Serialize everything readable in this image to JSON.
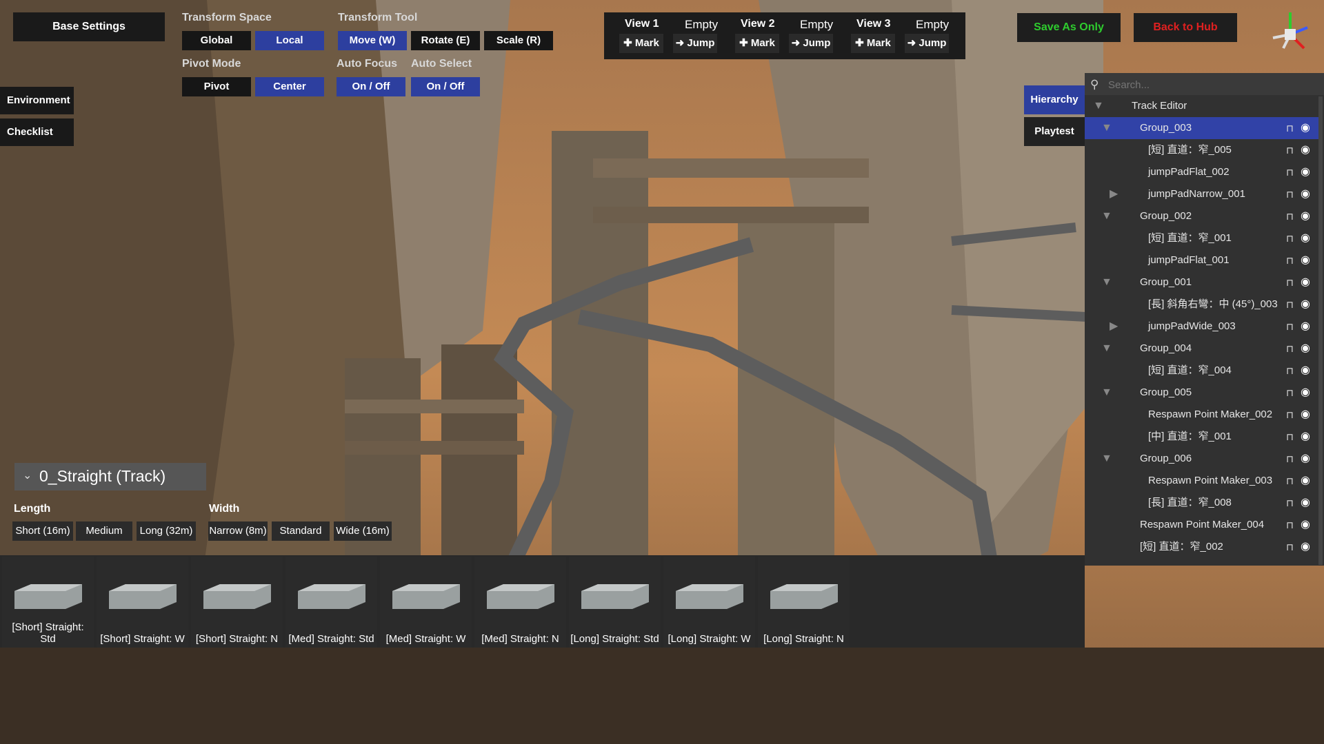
{
  "top": {
    "base_settings": "Base Settings",
    "transform_space": {
      "label": "Transform Space",
      "global": "Global",
      "local": "Local"
    },
    "transform_tool": {
      "label": "Transform Tool",
      "move": "Move (W)",
      "rotate": "Rotate (E)",
      "scale": "Scale (R)"
    },
    "pivot_mode": {
      "label": "Pivot Mode",
      "pivot": "Pivot",
      "center": "Center"
    },
    "auto_focus": {
      "label": "Auto Focus",
      "toggle": "On / Off"
    },
    "auto_select": {
      "label": "Auto Select",
      "toggle": "On / Off"
    },
    "save": "Save As Only",
    "back": "Back to Hub"
  },
  "views": [
    {
      "title": "View 1",
      "empty": "Empty",
      "mark": "✚ Mark",
      "jump": "➜ Jump"
    },
    {
      "title": "View 2",
      "empty": "Empty",
      "mark": "✚ Mark",
      "jump": "➜ Jump"
    },
    {
      "title": "View 3",
      "empty": "Empty",
      "mark": "✚ Mark",
      "jump": "➜ Jump"
    }
  ],
  "left": {
    "environment": "Environment",
    "checklist": "Checklist"
  },
  "tabs": {
    "hierarchy": "Hierarchy",
    "playtest": "Playtest"
  },
  "hierarchy": {
    "search_placeholder": "Search...",
    "items": [
      {
        "name": "Track Editor",
        "arrow": "▼"
      },
      {
        "name": "Group_003",
        "arrow": "▼"
      },
      {
        "name": "[短] 直道：窄_005",
        "arrow": ""
      },
      {
        "name": "jumpPadFlat_002",
        "arrow": ""
      },
      {
        "name": "jumpPadNarrow_001",
        "arrow": "▶"
      },
      {
        "name": "Group_002",
        "arrow": "▼"
      },
      {
        "name": "[短] 直道：窄_001",
        "arrow": ""
      },
      {
        "name": "jumpPadFlat_001",
        "arrow": ""
      },
      {
        "name": "Group_001",
        "arrow": "▼"
      },
      {
        "name": "[長] 斜角右彎：中 (45°)_003",
        "arrow": ""
      },
      {
        "name": "jumpPadWide_003",
        "arrow": "▶"
      },
      {
        "name": "Group_004",
        "arrow": "▼"
      },
      {
        "name": "[短] 直道：窄_004",
        "arrow": ""
      },
      {
        "name": "Group_005",
        "arrow": "▼"
      },
      {
        "name": "Respawn Point Maker_002",
        "arrow": ""
      },
      {
        "name": "[中] 直道：窄_001",
        "arrow": ""
      },
      {
        "name": "Group_006",
        "arrow": "▼"
      },
      {
        "name": "Respawn Point Maker_003",
        "arrow": ""
      },
      {
        "name": "[長] 直道：窄_008",
        "arrow": ""
      },
      {
        "name": "Respawn Point Maker_004",
        "arrow": ""
      },
      {
        "name": "[短] 直道：窄_002",
        "arrow": ""
      }
    ]
  },
  "track": {
    "selected": "0_Straight (Track)",
    "length_label": "Length",
    "length_options": [
      "Short (16m)",
      "Medium",
      "Long (32m)"
    ],
    "width_label": "Width",
    "width_options": [
      "Narrow (8m)",
      "Standard",
      "Wide (16m)"
    ]
  },
  "pieces": [
    "[Short] Straight: Std",
    "[Short] Straight: W",
    "[Short] Straight: N",
    "[Med] Straight: Std",
    "[Med] Straight: W",
    "[Med] Straight: N",
    "[Long] Straight: Std",
    "[Long] Straight: W",
    "[Long] Straight: N"
  ],
  "colors": {
    "accent_blue": "#2d3f9f",
    "save_green": "#2ecc2e",
    "back_red": "#e02020",
    "sky": "#c48a55"
  }
}
